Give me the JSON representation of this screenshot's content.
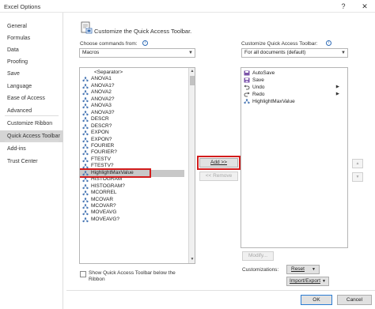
{
  "window": {
    "title": "Excel Options",
    "help_icon": "?",
    "close_icon": "✕"
  },
  "nav": {
    "items": [
      {
        "label": "General"
      },
      {
        "label": "Formulas"
      },
      {
        "label": "Data"
      },
      {
        "label": "Proofing"
      },
      {
        "label": "Save"
      },
      {
        "label": "Language"
      },
      {
        "label": "Ease of Access"
      },
      {
        "label": "Advanced"
      },
      {
        "label": "Customize Ribbon"
      },
      {
        "label": "Quick Access Toolbar"
      },
      {
        "label": "Add-ins"
      },
      {
        "label": "Trust Center"
      }
    ],
    "active_index": 9
  },
  "main": {
    "heading": "Customize the Quick Access Toolbar.",
    "choose_label": "Choose commands from:",
    "choose_value": "Macros",
    "customize_label": "Customize Quick Access Toolbar:",
    "customize_value": "For all documents (default)",
    "commands": [
      "<Separator>",
      "ANOVA1",
      "ANOVA1?",
      "ANOVA2",
      "ANOVA2?",
      "ANOVA3",
      "ANOVA3?",
      "DESCR",
      "DESCR?",
      "EXPON",
      "EXPON?",
      "FOURIER",
      "FOURIER?",
      "FTESTV",
      "FTESTV?",
      "HighlightMaxValue",
      "HISTOGRAM",
      "HISTOGRAM?",
      "MCORREL",
      "MCOVAR",
      "MCOVAR?",
      "MOVEAVG",
      "MOVEAVG?"
    ],
    "selected_command_index": 15,
    "toolbar_items": [
      {
        "label": "AutoSave",
        "icon": "autosave-icon",
        "has_arrow": false
      },
      {
        "label": "Save",
        "icon": "save-icon",
        "has_arrow": false
      },
      {
        "label": "Undo",
        "icon": "undo-icon",
        "has_arrow": true
      },
      {
        "label": "Redo",
        "icon": "redo-icon",
        "has_arrow": true
      },
      {
        "label": "HighlightMaxValue",
        "icon": "macro-icon",
        "has_arrow": false
      }
    ],
    "add_label": "Add >>",
    "remove_label": "<< Remove",
    "modify_label": "Modify...",
    "show_below_label": "Show Quick Access Toolbar below the Ribbon",
    "customizations_label": "Customizations:",
    "reset_label": "Reset",
    "import_export_label": "Import/Export",
    "ok_label": "OK",
    "cancel_label": "Cancel"
  },
  "colors": {
    "highlight": "#d21c1c",
    "selected_row": "#c8c8c8",
    "active_nav": "#d5d5d5"
  }
}
